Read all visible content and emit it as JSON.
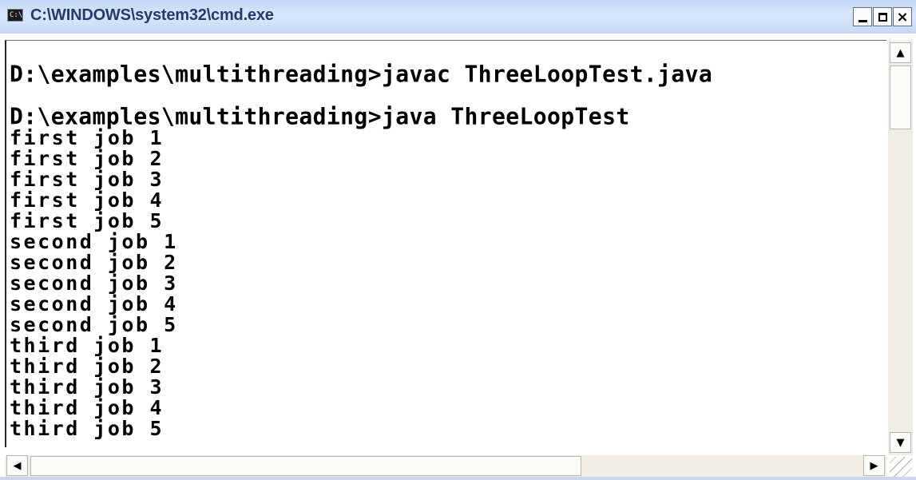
{
  "window": {
    "icon_text": "C:\\",
    "title": "C:\\WINDOWS\\system32\\cmd.exe",
    "controls": {
      "minimize": "_",
      "maximize": "□",
      "close": "×"
    }
  },
  "console": {
    "command_lines": [
      "D:\\examples\\multithreading>javac ThreeLoopTest.java",
      "D:\\examples\\multithreading>java ThreeLoopTest"
    ],
    "output_lines": [
      "first job 1",
      "first job 2",
      "first job 3",
      "first job 4",
      "first job 5",
      "second job 1",
      "second job 2",
      "second job 3",
      "second job 4",
      "second job 5",
      "third job 1",
      "third job 2",
      "third job 3",
      "third job 4",
      "third job 5"
    ]
  },
  "scrollbars": {
    "up_arrow": "▲",
    "down_arrow": "▼",
    "left_arrow": "◀",
    "right_arrow": "▶"
  }
}
